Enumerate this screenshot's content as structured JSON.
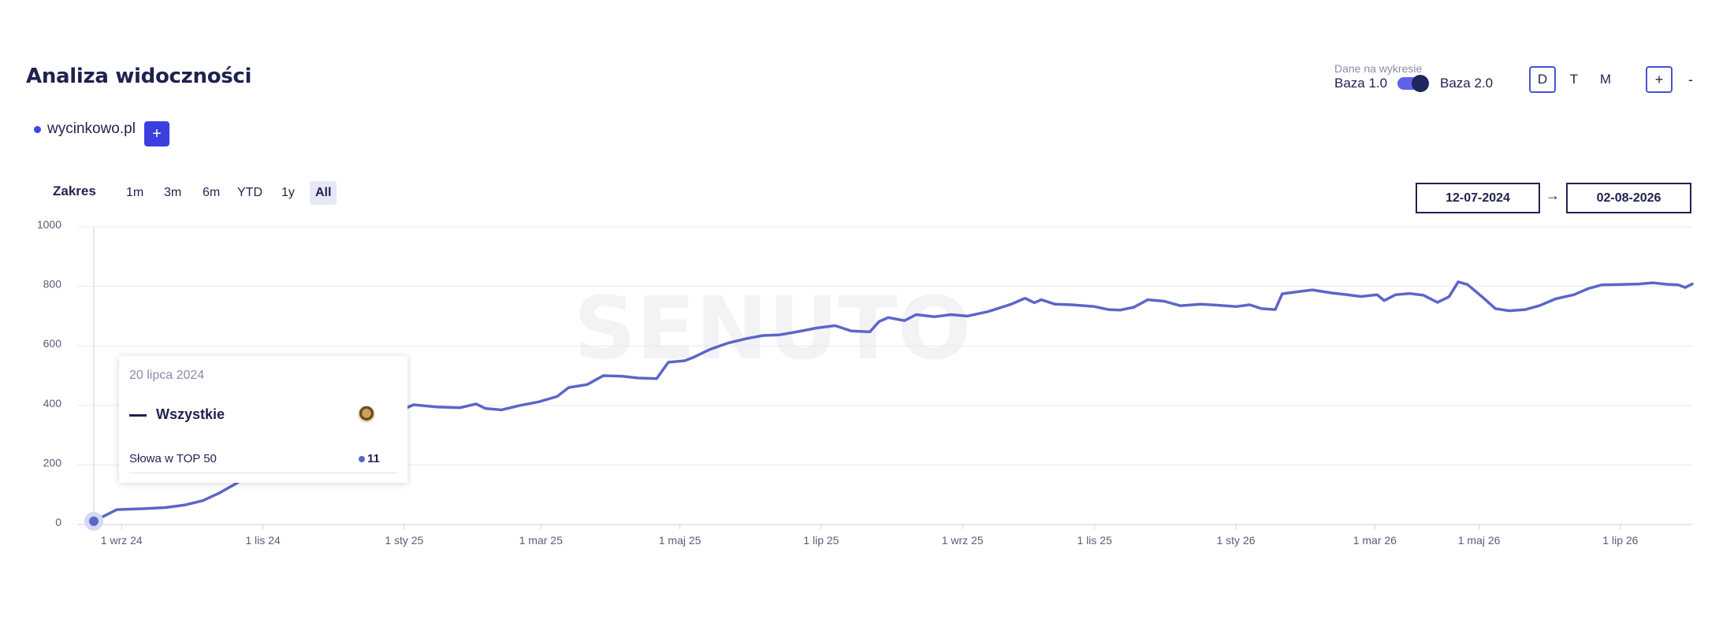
{
  "header": {
    "title": "Analiza widoczności",
    "data_label": "Dane na wykresie",
    "base_left": "Baza 1.0",
    "base_right": "Baza 2.0",
    "toggle_on": true,
    "periods": [
      "D",
      "T",
      "M"
    ],
    "active_period": "D",
    "zoom_in": "+",
    "zoom_out": "-"
  },
  "domains": {
    "name": "wycinkowo.pl",
    "add_label": "+"
  },
  "range": {
    "label": "Zakres",
    "buttons": [
      "1m",
      "3m",
      "6m",
      "YTD",
      "1y",
      "All"
    ],
    "active": "All",
    "start_date": "12-07-2024",
    "arrow": "→",
    "end_date": "02-08-2026"
  },
  "tooltip": {
    "date": "20 lipca 2024",
    "series": "Wszystkie",
    "metric_label": "Słowa w TOP 50",
    "metric_value": "11"
  },
  "watermark": "SENUTO",
  "colors": {
    "line": "#5b66c9",
    "accent": "#3b3fe0",
    "text": "#1f2250"
  },
  "chart_data": {
    "type": "line",
    "title": "",
    "xlabel": "",
    "ylabel": "",
    "ylim": [
      0,
      1000
    ],
    "yticks": [
      0,
      200,
      400,
      600,
      800,
      1000
    ],
    "xticks": [
      {
        "date": "2024-08-01",
        "label": "1 wrz 24"
      },
      {
        "date": "2024-10-01",
        "label": "1 lis 24"
      },
      {
        "date": "2024-12-01",
        "label": "1 sty 25"
      },
      {
        "date": "2025-01-29",
        "label": "1 mar 25"
      },
      {
        "date": "2025-03-30",
        "label": "1 maj 25"
      },
      {
        "date": "2025-05-30",
        "label": "1 lip 25"
      },
      {
        "date": "2025-07-30",
        "label": "1 wrz 25"
      },
      {
        "date": "2025-09-25",
        "label": "1 lis 25"
      },
      {
        "date": "2025-11-25",
        "label": "1 sty 26"
      },
      {
        "date": "2026-01-24",
        "label": "1 mar 26"
      },
      {
        "date": "2026-03-10",
        "label": "1 maj 26"
      },
      {
        "date": "2026-05-10",
        "label": "1 lip 26"
      }
    ],
    "x_start": "2024-07-20",
    "x_end": "2026-06-10",
    "series": [
      {
        "name": "Wszystkie",
        "points": [
          [
            "2024-07-20",
            11
          ],
          [
            "2024-07-30",
            50
          ],
          [
            "2024-08-10",
            53
          ],
          [
            "2024-08-20",
            57
          ],
          [
            "2024-08-28",
            65
          ],
          [
            "2024-09-05",
            80
          ],
          [
            "2024-09-12",
            105
          ],
          [
            "2024-09-20",
            140
          ],
          [
            "2024-09-28",
            190
          ],
          [
            "2024-10-05",
            235
          ],
          [
            "2024-10-12",
            260
          ],
          [
            "2024-10-18",
            283
          ],
          [
            "2024-10-25",
            275
          ],
          [
            "2024-11-01",
            305
          ],
          [
            "2024-11-07",
            330
          ],
          [
            "2024-11-12",
            355
          ],
          [
            "2024-11-20",
            365
          ],
          [
            "2024-11-28",
            378
          ],
          [
            "2024-12-05",
            402
          ],
          [
            "2024-12-15",
            395
          ],
          [
            "2024-12-25",
            392
          ],
          [
            "2025-01-01",
            405
          ],
          [
            "2025-01-05",
            390
          ],
          [
            "2025-01-12",
            385
          ],
          [
            "2025-01-20",
            400
          ],
          [
            "2025-01-28",
            412
          ],
          [
            "2025-02-05",
            430
          ],
          [
            "2025-02-10",
            460
          ],
          [
            "2025-02-18",
            470
          ],
          [
            "2025-02-25",
            500
          ],
          [
            "2025-03-05",
            498
          ],
          [
            "2025-03-12",
            492
          ],
          [
            "2025-03-20",
            490
          ],
          [
            "2025-03-25",
            545
          ],
          [
            "2025-04-01",
            550
          ],
          [
            "2025-04-05",
            562
          ],
          [
            "2025-04-12",
            588
          ],
          [
            "2025-04-20",
            610
          ],
          [
            "2025-04-28",
            625
          ],
          [
            "2025-05-05",
            635
          ],
          [
            "2025-05-12",
            637
          ],
          [
            "2025-05-20",
            648
          ],
          [
            "2025-05-28",
            660
          ],
          [
            "2025-06-05",
            668
          ],
          [
            "2025-06-12",
            650
          ],
          [
            "2025-06-20",
            647
          ],
          [
            "2025-06-24",
            682
          ],
          [
            "2025-06-28",
            695
          ],
          [
            "2025-07-05",
            685
          ],
          [
            "2025-07-10",
            705
          ],
          [
            "2025-07-18",
            698
          ],
          [
            "2025-07-25",
            705
          ],
          [
            "2025-08-01",
            700
          ],
          [
            "2025-08-10",
            715
          ],
          [
            "2025-08-20",
            740
          ],
          [
            "2025-08-26",
            760
          ],
          [
            "2025-08-30",
            745
          ],
          [
            "2025-09-02",
            755
          ],
          [
            "2025-09-08",
            740
          ],
          [
            "2025-09-15",
            738
          ],
          [
            "2025-09-25",
            732
          ],
          [
            "2025-10-01",
            722
          ],
          [
            "2025-10-06",
            720
          ],
          [
            "2025-10-12",
            730
          ],
          [
            "2025-10-18",
            755
          ],
          [
            "2025-10-25",
            750
          ],
          [
            "2025-11-01",
            735
          ],
          [
            "2025-11-10",
            740
          ],
          [
            "2025-11-18",
            736
          ],
          [
            "2025-11-25",
            732
          ],
          [
            "2025-12-01",
            738
          ],
          [
            "2025-12-06",
            725
          ],
          [
            "2025-12-12",
            722
          ],
          [
            "2025-12-15",
            775
          ],
          [
            "2025-12-22",
            782
          ],
          [
            "2025-12-28",
            788
          ],
          [
            "2026-01-05",
            778
          ],
          [
            "2026-01-12",
            772
          ],
          [
            "2026-01-18",
            766
          ],
          [
            "2026-01-25",
            772
          ],
          [
            "2026-01-28",
            752
          ],
          [
            "2026-02-02",
            772
          ],
          [
            "2026-02-08",
            776
          ],
          [
            "2026-02-14",
            770
          ],
          [
            "2026-02-20",
            746
          ],
          [
            "2026-02-25",
            765
          ],
          [
            "2026-03-01",
            815
          ],
          [
            "2026-03-05",
            806
          ],
          [
            "2026-03-12",
            760
          ],
          [
            "2026-03-17",
            725
          ],
          [
            "2026-03-23",
            718
          ],
          [
            "2026-03-30",
            722
          ],
          [
            "2026-04-05",
            735
          ],
          [
            "2026-04-12",
            758
          ],
          [
            "2026-04-20",
            772
          ],
          [
            "2026-04-26",
            792
          ],
          [
            "2026-05-02",
            805
          ],
          [
            "2026-05-10",
            806
          ],
          [
            "2026-05-18",
            808
          ],
          [
            "2026-05-24",
            812
          ],
          [
            "2026-05-30",
            807
          ],
          [
            "2026-06-04",
            805
          ],
          [
            "2026-06-07",
            796
          ],
          [
            "2026-06-10",
            808
          ]
        ]
      }
    ]
  }
}
